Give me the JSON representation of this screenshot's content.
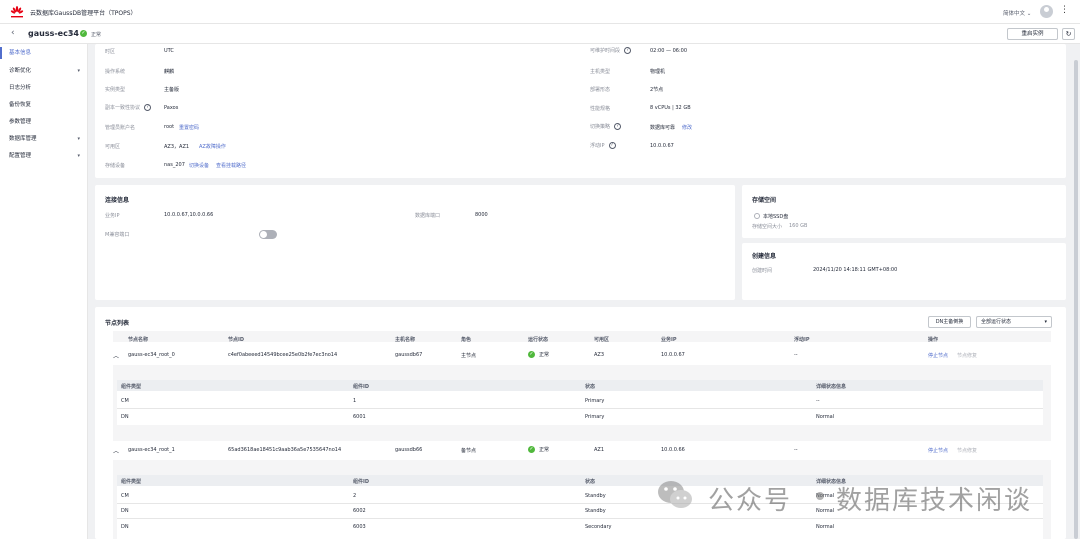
{
  "app": {
    "title": "云数据库GaussDB管理平台（TPOPS）",
    "lang": "简体中文"
  },
  "instance": {
    "name": "gauss-ec34",
    "status": "正常",
    "restart_label": "重启实例"
  },
  "sidebar": {
    "items": [
      {
        "label": "基本信息",
        "active": true,
        "expandable": false
      },
      {
        "label": "诊断优化",
        "active": false,
        "expandable": true
      },
      {
        "label": "日志分析",
        "active": false,
        "expandable": false
      },
      {
        "label": "备份恢复",
        "active": false,
        "expandable": false
      },
      {
        "label": "参数管理",
        "active": false,
        "expandable": false
      },
      {
        "label": "数据库管理",
        "active": false,
        "expandable": true
      },
      {
        "label": "配置管理",
        "active": false,
        "expandable": true
      }
    ]
  },
  "basic": {
    "left": [
      {
        "label": "时区",
        "value": "UTC"
      },
      {
        "label": "操作系统",
        "value": "麒麟"
      },
      {
        "label": "实例类型",
        "value": "主备版"
      },
      {
        "label": "副本一致性协议",
        "value": "Paxos",
        "help": true
      },
      {
        "label": "管理员账户名",
        "value": "root",
        "link": "重置密码"
      },
      {
        "label": "可用区",
        "value": "AZ3，AZ1",
        "link": "AZ故障操作"
      },
      {
        "label": "存储设备",
        "value": "nas_207",
        "link": "切换设备",
        "link2": "查看挂载路径"
      }
    ],
    "right": [
      {
        "label": "可维护时间段",
        "value": "02:00 — 06:00",
        "help": true
      },
      {
        "label": "主机类型",
        "value": "物理机"
      },
      {
        "label": "部署形态",
        "value": "2节点"
      },
      {
        "label": "性能规格",
        "value": "8 vCPUs | 32 GB"
      },
      {
        "label": "切换策略",
        "value": "数据库可靠",
        "link": "修改",
        "help": true
      },
      {
        "label": "浮动IP",
        "value": "10.0.0.67",
        "help": true
      }
    ]
  },
  "connection": {
    "title": "连接信息",
    "biz_ip_label": "业务IP",
    "biz_ip": "10.0.0.67,10.0.0.66",
    "port_label": "数据库端口",
    "port": "8000",
    "m_port_label": "M兼容端口"
  },
  "storage": {
    "title": "存储空间",
    "disk": "本地SSD盘",
    "size_label": "存储空间大小",
    "size": "160 GB"
  },
  "created": {
    "title": "创建信息",
    "label": "创建时间",
    "value": "2024/11/20 14:18:11 GMT+08:00"
  },
  "nodes": {
    "title": "节点列表",
    "dn_switch_label": "DN主备倒换",
    "filter": "全部运行状态",
    "columns": [
      "节点名称",
      "节点ID",
      "主机名称",
      "角色",
      "运行状态",
      "可用区",
      "业务IP",
      "浮动IP",
      "操作"
    ],
    "sub_columns": [
      "组件类型",
      "组件ID",
      "状态",
      "详细状态信息"
    ],
    "rows": [
      {
        "name": "gauss-ec34_root_0",
        "id": "c4ef0abeeed14549bcee25e0b2fe7ec3no14",
        "host": "gaussdb67",
        "role": "主节点",
        "status": "正常",
        "az": "AZ3",
        "ip": "10.0.0.67",
        "float_ip": "--",
        "op1": "停止节点",
        "op2": "节点修复",
        "components": [
          {
            "type": "CM",
            "id": "1",
            "state": "Primary",
            "detail": "--"
          },
          {
            "type": "DN",
            "id": "6001",
            "state": "Primary",
            "detail": "Normal"
          }
        ]
      },
      {
        "name": "gauss-ec34_root_1",
        "id": "65ad3618ae18451c9aab36a5e7535647no14",
        "host": "gaussdb66",
        "role": "备节点",
        "status": "正常",
        "az": "AZ1",
        "ip": "10.0.0.66",
        "float_ip": "--",
        "op1": "停止节点",
        "op2": "节点修复",
        "components": [
          {
            "type": "CM",
            "id": "2",
            "state": "Standby",
            "detail": "Normal"
          },
          {
            "type": "DN",
            "id": "6002",
            "state": "Standby",
            "detail": "Normal"
          },
          {
            "type": "DN",
            "id": "6003",
            "state": "Secondary",
            "detail": "Normal"
          }
        ]
      }
    ]
  },
  "watermark": {
    "text": "公众号",
    "text2": "数据库技术闲谈"
  },
  "colors": {
    "accent": "#526ecc",
    "ok": "#50b83c",
    "logo_red": "#e60012"
  }
}
